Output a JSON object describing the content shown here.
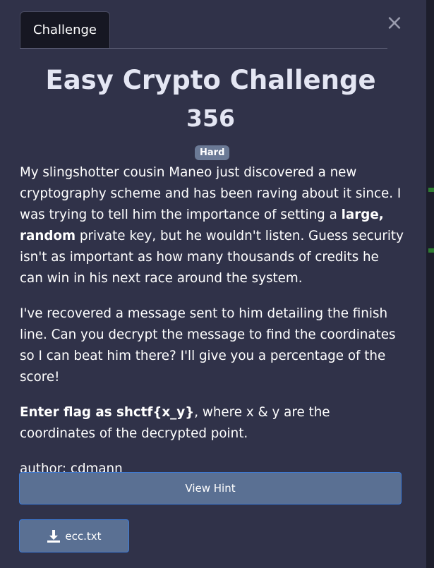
{
  "tab": {
    "label": "Challenge"
  },
  "close": {
    "glyph": "×"
  },
  "challenge": {
    "title": "Easy Crypto Challenge",
    "points": "356",
    "difficulty": "Hard"
  },
  "description": {
    "p1_a": "My slingshotter cousin Maneo just discovered a new cryptography scheme and has been raving about it since. I was trying to tell him the importance of setting a ",
    "p1_bold": "large, random",
    "p1_b": " private key, but he wouldn't listen. Guess security isn't as important as how many thousands of credits he can win in his next race around the system.",
    "p2": "I've recovered a message sent to him detailing the finish line. Can you decrypt the message to find the coordinates so I can beat him there? I'll give you a percentage of the score!",
    "p3_bold": "Enter flag as shctf{x_y}",
    "p3_rest": ", where x & y are the coordinates of the decrypted point.",
    "author": "author: cdmann"
  },
  "actions": {
    "hint_label": "View Hint",
    "file_label": "ecc.txt",
    "file_icon": "download-icon"
  },
  "colors": {
    "modal_bg": "#303249",
    "tab_bg": "#161722",
    "badge_bg": "#6b7a96",
    "button_bg": "#5a7093",
    "button_border": "#3d7bd6"
  }
}
